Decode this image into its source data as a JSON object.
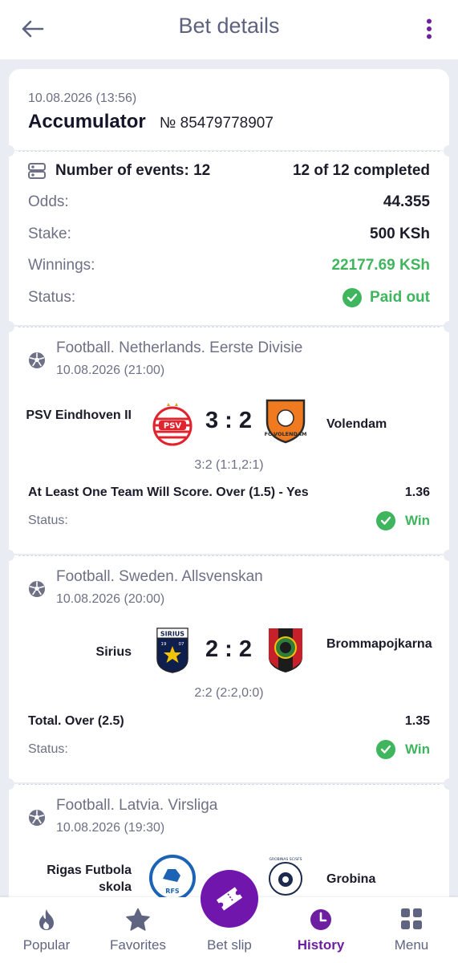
{
  "header": {
    "title": "Bet details"
  },
  "bet": {
    "datetime": "10.08.2026 (13:56)",
    "type": "Accumulator",
    "number": "№ 85479778907",
    "events_label": "Number of events: 12",
    "completed": "12 of 12 completed",
    "odds_label": "Odds:",
    "odds": "44.355",
    "stake_label": "Stake:",
    "stake": "500 KSh",
    "winnings_label": "Winnings:",
    "winnings": "22177.69 KSh",
    "status_label": "Status:",
    "status": "Paid out"
  },
  "events": [
    {
      "league": "Football. Netherlands. Eerste Divisie",
      "datetime": "10.08.2026 (21:00)",
      "home": "PSV Eindhoven II",
      "away": "Volendam",
      "score": "3 : 2",
      "detail": "3:2 (1:1,2:1)",
      "market": "At Least One Team Will Score. Over (1.5) - Yes",
      "odd": "1.36",
      "status_label": "Status:",
      "status": "Win"
    },
    {
      "league": "Football. Sweden. Allsvenskan",
      "datetime": "10.08.2026 (20:00)",
      "home": "Sirius",
      "away": "Brommapojkarna",
      "score": "2 : 2",
      "detail": "2:2 (2:2,0:0)",
      "market": "Total. Over (2.5)",
      "odd": "1.35",
      "status_label": "Status:",
      "status": "Win"
    },
    {
      "league": "Football. Latvia. Virsliga",
      "datetime": "10.08.2026 (19:30)",
      "home": "Rigas Futbola skola",
      "away": "Grobina",
      "score": "",
      "detail": "",
      "market": "",
      "odd": "",
      "status_label": "",
      "status": ""
    }
  ],
  "logos": {
    "psv": "PSV",
    "volendam": "FC VOLENDAM",
    "sirius": "SIRIUS",
    "sirius_years": [
      "19",
      "07"
    ],
    "rfs": "RFS",
    "grobina": "GROBINAS SC/SFS"
  },
  "nav": [
    {
      "label": "Popular",
      "icon": "flame-icon"
    },
    {
      "label": "Favorites",
      "icon": "star-icon"
    },
    {
      "label": "Bet slip",
      "icon": "ticket-icon"
    },
    {
      "label": "History",
      "icon": "clock-icon"
    },
    {
      "label": "Menu",
      "icon": "grid-icon"
    }
  ],
  "colors": {
    "accent": "#6d1ea1",
    "success": "#3fb55e",
    "header_text": "#5d6280",
    "background": "#eaecf3"
  }
}
